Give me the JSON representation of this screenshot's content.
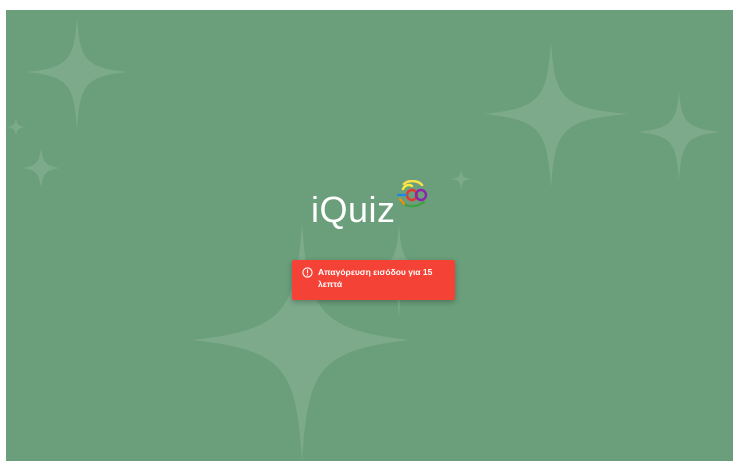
{
  "app": {
    "name": "iQuiz"
  },
  "alert": {
    "icon": "error-outline-icon",
    "message": "Απαγόρευση εισόδου για 15 λεπτά"
  },
  "colors": {
    "background": "#6b9f7b",
    "alert": "#f44336",
    "text": "#ffffff"
  }
}
